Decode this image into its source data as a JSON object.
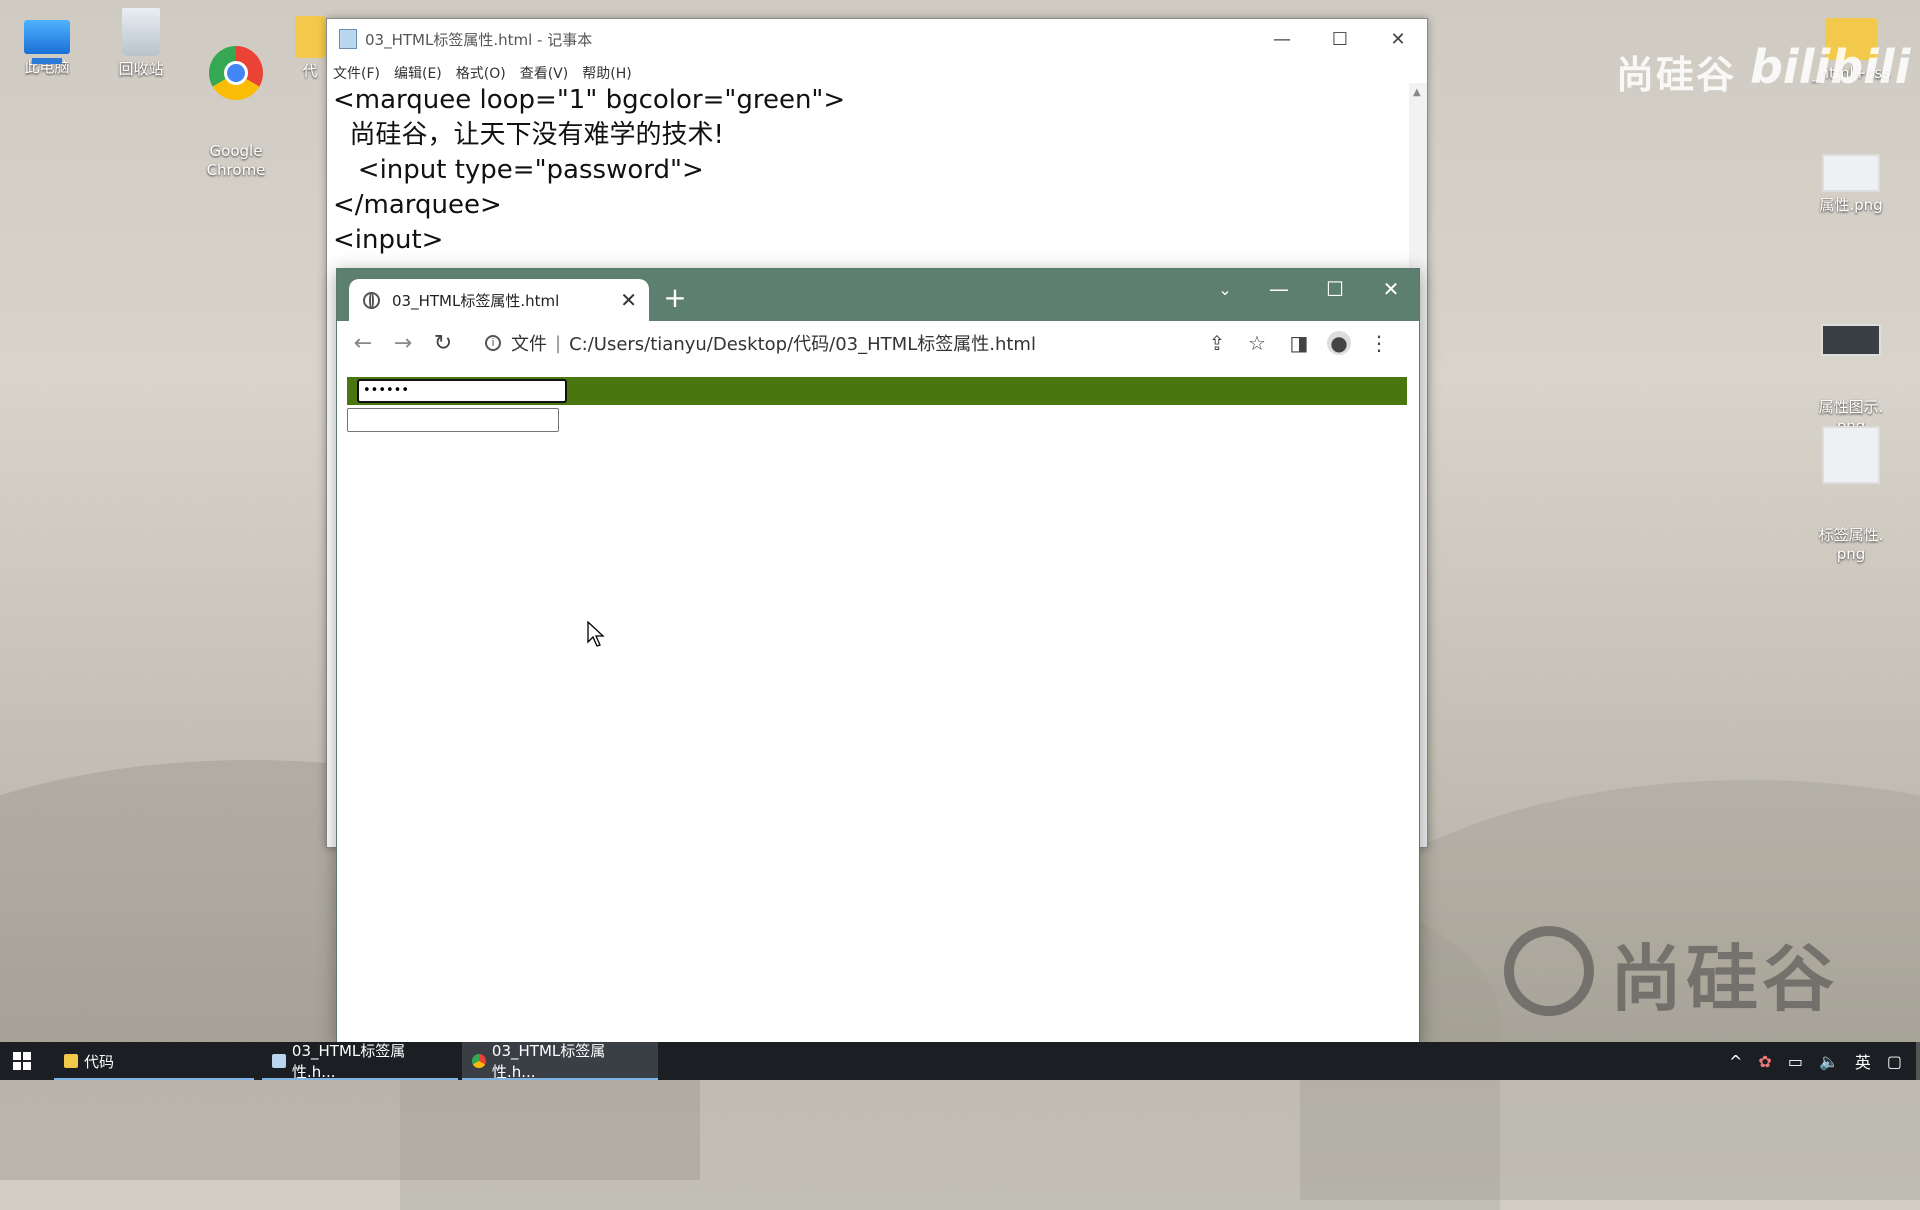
{
  "desktop": {
    "icons": [
      {
        "label": "此电脑"
      },
      {
        "label": "回收站"
      },
      {
        "label": "Google\nChrome"
      },
      {
        "label": "代"
      }
    ],
    "right_icons": [
      {
        "label": "_html+css"
      },
      {
        "label": "属性.png"
      },
      {
        "label": "属性图示.\npng"
      },
      {
        "label": "标签属性.\npng"
      }
    ],
    "watermark_top": "尚硅谷",
    "watermark_bili": "bilibili",
    "watermark_bottom": "尚硅谷"
  },
  "notepad": {
    "title": "03_HTML标签属性.html - 记事本",
    "menu": [
      "文件(F)",
      "编辑(E)",
      "格式(O)",
      "查看(V)",
      "帮助(H)"
    ],
    "code": "<marquee loop=\"1\" bgcolor=\"green\">\n  尚硅谷，让天下没有难学的技术!\n   <input type=\"password\">\n</marquee>\n<input>"
  },
  "browser": {
    "tab_title": "03_HTML标签属性.html",
    "address_prefix": "文件",
    "url": "C:/Users/tianyu/Desktop/代码/03_HTML标签属性.html",
    "password_value": "••••••",
    "marquee_bg": "#4a7610",
    "frame_color": "#5d7f70"
  },
  "taskbar": {
    "items": [
      {
        "label": "代码"
      },
      {
        "label": "03_HTML标签属性.h..."
      },
      {
        "label": "03_HTML标签属性.h..."
      }
    ],
    "ime": "英"
  }
}
